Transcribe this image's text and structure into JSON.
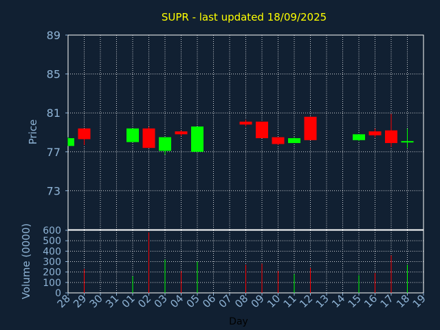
{
  "chart_data": {
    "type": "candlestick",
    "title": "SUPR - last updated 18/09/2025",
    "price_ylabel": "Price",
    "volume_ylabel": "Volume (0000)",
    "xlabel": "Day",
    "price_ylim": [
      69,
      89
    ],
    "price_ticks": [
      "89",
      "85",
      "81",
      "77",
      "73"
    ],
    "volume_ylim": [
      0,
      600
    ],
    "volume_ticks": [
      "600",
      "500",
      "400",
      "300",
      "200",
      "100",
      "0"
    ],
    "x_ticks": [
      "28",
      "29",
      "30",
      "31",
      "01",
      "02",
      "03",
      "04",
      "05",
      "06",
      "07",
      "08",
      "09",
      "10",
      "11",
      "12",
      "13",
      "14",
      "15",
      "16",
      "17",
      "18",
      "19"
    ],
    "grid": true,
    "colors": {
      "up": "#00ff00",
      "down": "#ff0000",
      "grid": "#ffffff",
      "axis_text": "#8fb4d6",
      "title": "#ffff00",
      "background": "#112032"
    },
    "candles": [
      {
        "day": "28",
        "open": 77.6,
        "high": 78.5,
        "low": 77.6,
        "close": 78.4,
        "volume": 0
      },
      {
        "day": "29",
        "open": 79.4,
        "high": 79.4,
        "low": 77.7,
        "close": 78.3,
        "volume": 230
      },
      {
        "day": "01",
        "open": 78.0,
        "high": 79.4,
        "low": 78.0,
        "close": 79.4,
        "volume": 160
      },
      {
        "day": "02",
        "open": 79.4,
        "high": 79.6,
        "low": 77.4,
        "close": 77.4,
        "volume": 580
      },
      {
        "day": "03",
        "open": 77.1,
        "high": 78.5,
        "low": 76.7,
        "close": 78.5,
        "volume": 320
      },
      {
        "day": "04",
        "open": 79.1,
        "high": 79.2,
        "low": 78.6,
        "close": 78.8,
        "volume": 210
      },
      {
        "day": "05",
        "open": 77.0,
        "high": 79.6,
        "low": 77.0,
        "close": 79.6,
        "volume": 300
      },
      {
        "day": "08",
        "open": 80.1,
        "high": 80.3,
        "low": 79.6,
        "close": 79.8,
        "volume": 270
      },
      {
        "day": "09",
        "open": 80.1,
        "high": 80.1,
        "low": 78.4,
        "close": 78.4,
        "volume": 280
      },
      {
        "day": "10",
        "open": 78.5,
        "high": 78.5,
        "low": 77.7,
        "close": 77.8,
        "volume": 210
      },
      {
        "day": "11",
        "open": 77.9,
        "high": 78.5,
        "low": 77.9,
        "close": 78.4,
        "volume": 180
      },
      {
        "day": "12",
        "open": 80.6,
        "high": 80.6,
        "low": 78.2,
        "close": 78.2,
        "volume": 240
      },
      {
        "day": "15",
        "open": 78.2,
        "high": 78.8,
        "low": 78.1,
        "close": 78.8,
        "volume": 170
      },
      {
        "day": "16",
        "open": 79.1,
        "high": 79.4,
        "low": 78.5,
        "close": 78.7,
        "volume": 190
      },
      {
        "day": "17",
        "open": 79.2,
        "high": 80.9,
        "low": 77.5,
        "close": 77.9,
        "volume": 360
      },
      {
        "day": "18",
        "open": 78.0,
        "high": 79.4,
        "low": 77.4,
        "close": 78.1,
        "volume": 270
      }
    ]
  }
}
